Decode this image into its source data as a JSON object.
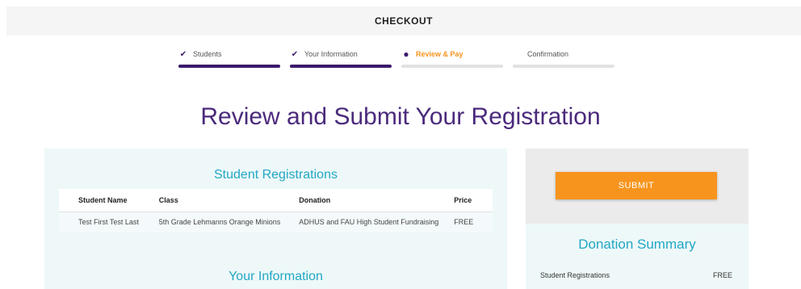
{
  "header": {
    "title": "CHECKOUT"
  },
  "steps": [
    {
      "label": "Students",
      "status": "done",
      "icon": "check-icon"
    },
    {
      "label": "Your Information",
      "status": "done",
      "icon": "check-icon"
    },
    {
      "label": "Review & Pay",
      "status": "active",
      "icon": "dot-icon"
    },
    {
      "label": "Confirmation",
      "status": "pending",
      "icon": ""
    }
  ],
  "page_title": "Review and Submit Your Registration",
  "registrations": {
    "title": "Student Registrations",
    "columns": [
      "Student Name",
      "Class",
      "Donation",
      "Price"
    ],
    "rows": [
      {
        "student_name": "Test First Test Last",
        "class": "5th Grade Lehmanns Orange Minions",
        "donation": "ADHUS and FAU High Student Fundraising",
        "price": "FREE"
      }
    ]
  },
  "your_information": {
    "title": "Your Information"
  },
  "sidebar": {
    "submit_label": "SUBMIT",
    "summary_title": "Donation Summary",
    "summary_rows": [
      {
        "label": "Student Registrations",
        "value": "FREE"
      }
    ]
  },
  "colors": {
    "brand_purple": "#3b1a6b",
    "accent_orange": "#f7941d",
    "teal": "#22a7c4",
    "title_purple": "#4b2a7c"
  }
}
